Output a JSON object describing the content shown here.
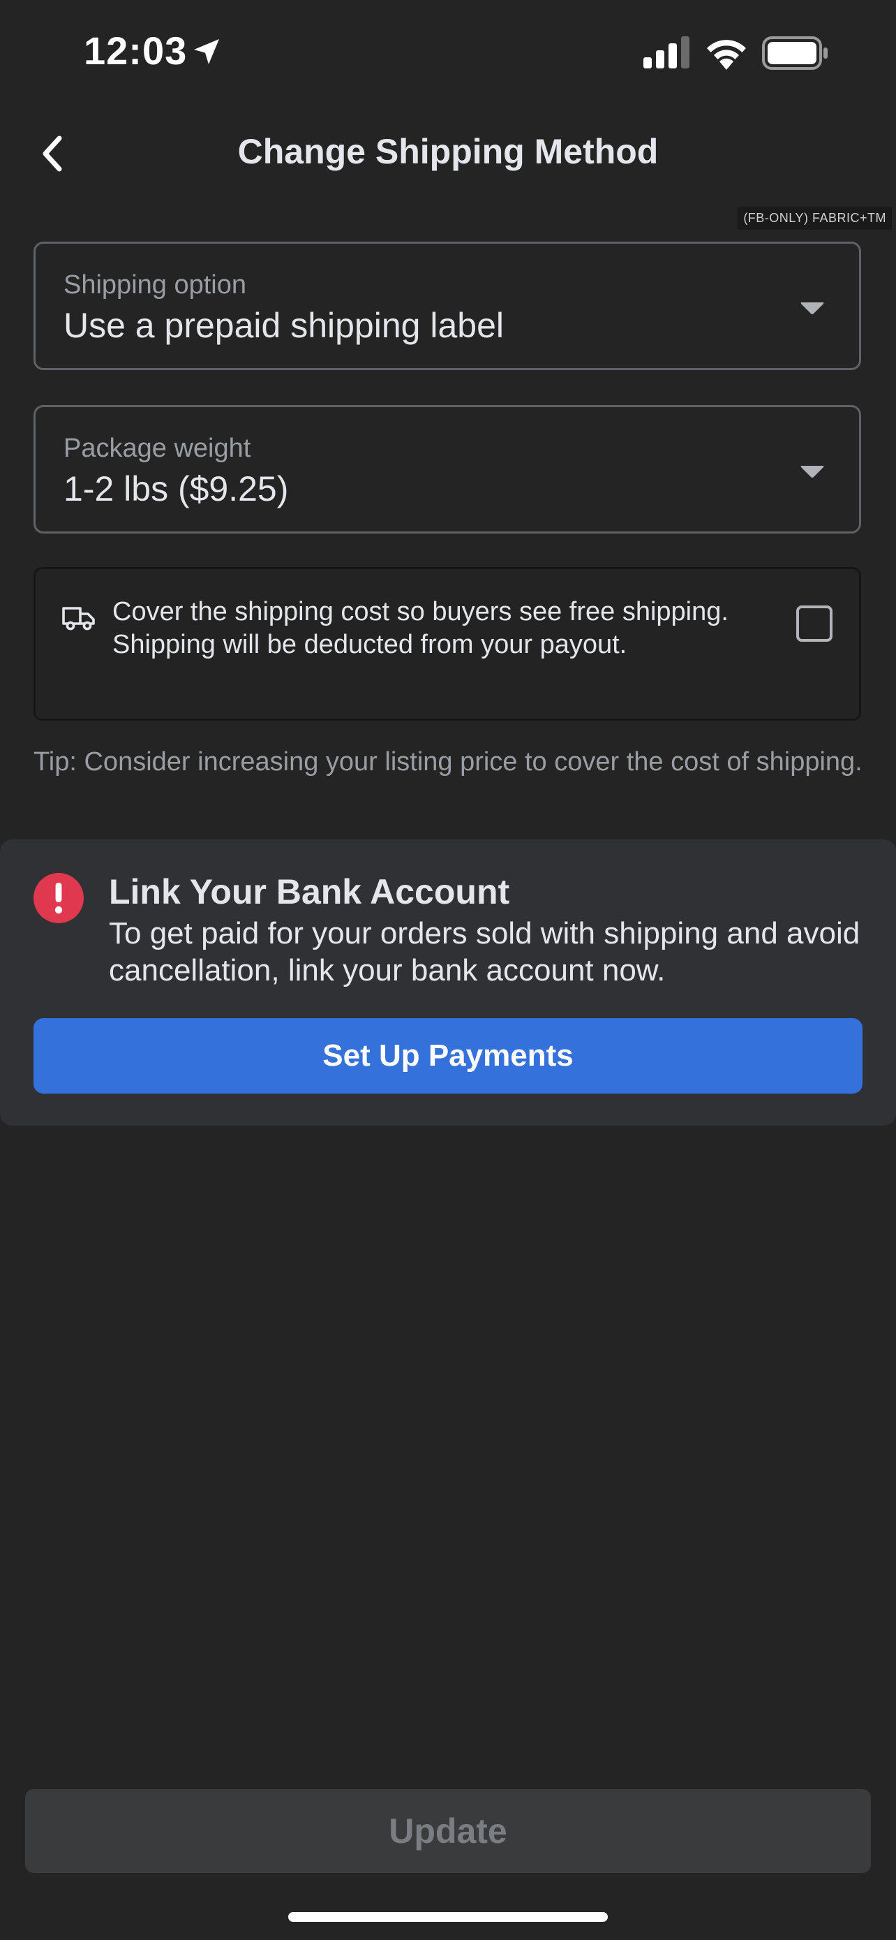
{
  "status_bar": {
    "time": "12:03"
  },
  "header": {
    "title": "Change Shipping Method",
    "debug_tag": "(FB-ONLY) FABRIC+TM"
  },
  "shipping_option": {
    "label": "Shipping option",
    "value": "Use a prepaid shipping label"
  },
  "package_weight": {
    "label": "Package weight",
    "value": "1-2 lbs ($9.25)"
  },
  "cover_shipping": {
    "text": "Cover the shipping cost so buyers see free shipping. Shipping will be deducted from your payout.",
    "checked": false
  },
  "tip": "Tip: Consider increasing your listing price to cover the cost of shipping.",
  "bank_banner": {
    "title": "Link Your Bank Account",
    "body": "To get paid for your orders sold with shipping and avoid cancellation, link your bank account now.",
    "button_label": "Set Up Payments"
  },
  "footer": {
    "update_label": "Update"
  },
  "colors": {
    "background": "#242424",
    "accent": "#3571db",
    "alert": "#e0384f"
  },
  "icons": [
    "location-arrow-icon",
    "cellular-signal-icon",
    "wifi-icon",
    "battery-icon",
    "chevron-left-icon",
    "caret-down-icon",
    "truck-icon",
    "alert-icon"
  ]
}
